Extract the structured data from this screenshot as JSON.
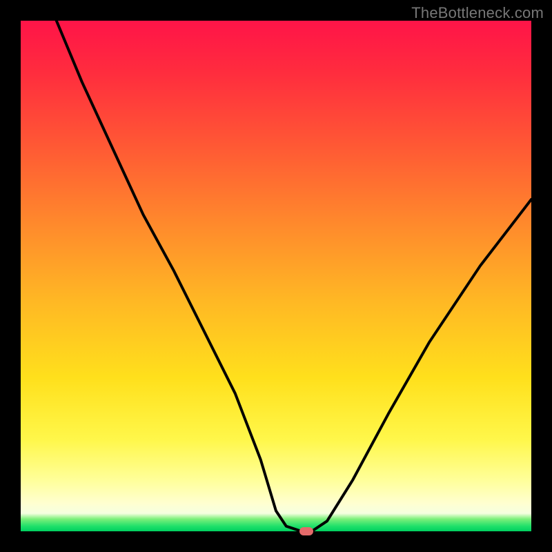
{
  "attribution": "TheBottleneck.com",
  "chart_data": {
    "type": "line",
    "title": "",
    "xlabel": "",
    "ylabel": "",
    "xlim": [
      0,
      100
    ],
    "ylim": [
      0,
      100
    ],
    "grid": false,
    "legend": false,
    "series": [
      {
        "name": "curve",
        "x": [
          7,
          12,
          18,
          24,
          30,
          36,
          42,
          47,
          50,
          52,
          55,
          57,
          60,
          65,
          72,
          80,
          90,
          100
        ],
        "values": [
          100,
          88,
          75,
          62,
          51,
          39,
          27,
          14,
          4,
          1,
          0,
          0,
          2,
          10,
          23,
          37,
          52,
          65
        ]
      }
    ],
    "marker": {
      "x": 56,
      "y": 0,
      "color": "#e46a6a"
    },
    "background_gradient": {
      "top": "#ff1448",
      "mid": "#ffd820",
      "bottom": "#00d060"
    }
  }
}
